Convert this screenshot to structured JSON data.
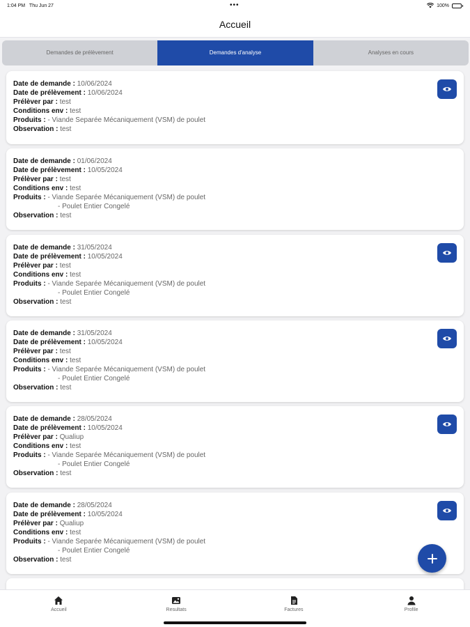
{
  "status_bar": {
    "time": "1:04 PM",
    "date": "Thu Jun 27",
    "dots": "•••",
    "battery": "100%"
  },
  "header": {
    "title": "Accueil"
  },
  "tabs": [
    {
      "label": "Demandes de prélèvement",
      "active": false
    },
    {
      "label": "Demandes d'analyse",
      "active": true
    },
    {
      "label": "Analyses en cours",
      "active": false
    }
  ],
  "labels": {
    "date_demande": "Date de demande :",
    "date_prelevement": "Date de prélèvement :",
    "preleve_par": "Prélèver par :",
    "conditions": "Conditions env :",
    "produits": "Produits :",
    "observation": "Observation :"
  },
  "cards": [
    {
      "date_demande": "10/06/2024",
      "date_prelevement": "10/06/2024",
      "preleve_par": "test",
      "conditions": "test",
      "produits": [
        "- Viande Separée Mécaniquement (VSM) de poulet"
      ],
      "observation": "test",
      "has_view": true
    },
    {
      "date_demande": "01/06/2024",
      "date_prelevement": "10/05/2024",
      "preleve_par": "test",
      "conditions": "test",
      "produits": [
        "- Viande Separée Mécaniquement (VSM) de poulet",
        "- Poulet Entier Congelé"
      ],
      "observation": "test",
      "has_view": false
    },
    {
      "date_demande": "31/05/2024",
      "date_prelevement": "10/05/2024",
      "preleve_par": "test",
      "conditions": "test",
      "produits": [
        "- Viande Separée Mécaniquement (VSM) de poulet",
        "- Poulet Entier Congelé"
      ],
      "observation": "test",
      "has_view": true
    },
    {
      "date_demande": "31/05/2024",
      "date_prelevement": "10/05/2024",
      "preleve_par": "test",
      "conditions": "test",
      "produits": [
        "- Viande Separée Mécaniquement (VSM) de poulet",
        "- Poulet Entier Congelé"
      ],
      "observation": "test",
      "has_view": true
    },
    {
      "date_demande": "28/05/2024",
      "date_prelevement": "10/05/2024",
      "preleve_par": "Qualiup",
      "conditions": "test",
      "produits": [
        "- Viande Separée Mécaniquement (VSM) de poulet",
        "- Poulet Entier Congelé"
      ],
      "observation": "test",
      "has_view": true
    },
    {
      "date_demande": "28/05/2024",
      "date_prelevement": "10/05/2024",
      "preleve_par": "Qualiup",
      "conditions": "test",
      "produits": [
        "- Viande Separée Mécaniquement (VSM) de poulet",
        "- Poulet Entier Congelé"
      ],
      "observation": "test",
      "has_view": true
    }
  ],
  "bottom_nav": [
    {
      "label": "Accueil",
      "icon": "home-icon"
    },
    {
      "label": "Resultats",
      "icon": "image-icon"
    },
    {
      "label": "Factures",
      "icon": "document-icon"
    },
    {
      "label": "Profile",
      "icon": "user-icon"
    }
  ],
  "colors": {
    "accent": "#1f4ba8",
    "background": "#f2f2f4",
    "tab_inactive": "#cfd1d6"
  }
}
